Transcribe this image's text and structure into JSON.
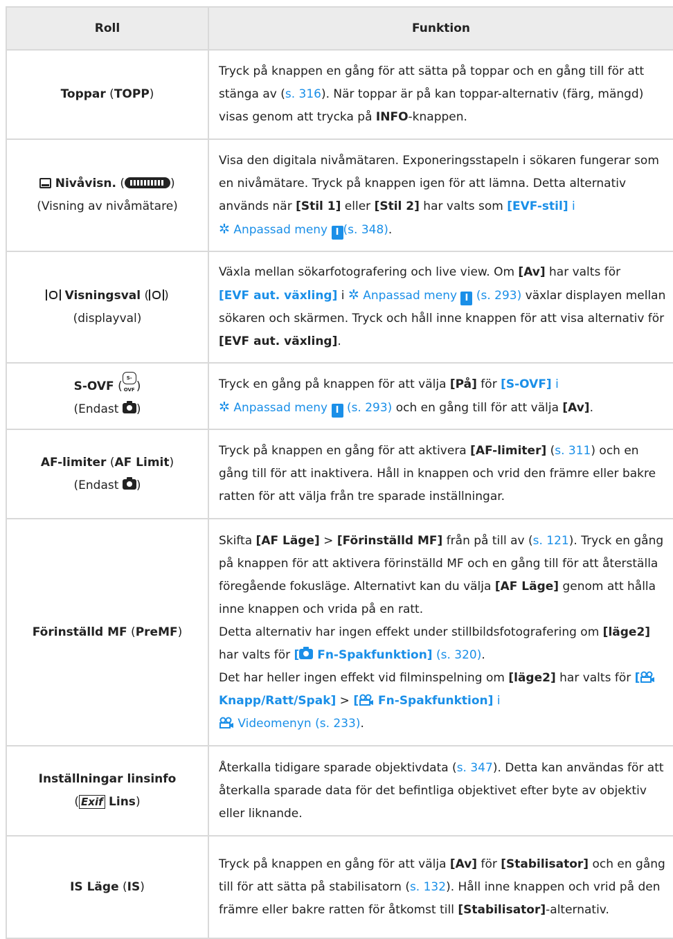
{
  "header": {
    "col1": "Roll",
    "col2": "Funktion"
  },
  "icons": {
    "gear": "gear-icon",
    "custom_menu_number": "I",
    "camera": "camera-icon",
    "video": "video-icon",
    "level": "level-display-icon",
    "level_bar": "level-gauge-icon",
    "display_select": "display-select-icon",
    "sovf": "S-OVF",
    "exif": "Exif"
  },
  "colors": {
    "link": "#1a8fe8",
    "header_bg": "#ececec",
    "border": "#d9d9d9"
  },
  "rows": [
    {
      "role": {
        "name": "Toppar",
        "abbr": "TOPP"
      },
      "func": {
        "t1": "Tryck på knappen en gång för att sätta på toppar och en gång till för att stänga av (",
        "ref1": "s. 316",
        "t2": "). När toppar är på kan toppar-alternativ (färg, mängd) visas genom att trycka på ",
        "b1": "INFO",
        "t3": "-knappen."
      }
    },
    {
      "role": {
        "name": "Nivåvisn.",
        "sub": "(Visning av nivåmätare)"
      },
      "func": {
        "t1": "Visa den digitala nivåmätaren. Exponeringsstapeln i sökaren fungerar som en nivåmätare. Tryck på knappen igen för att lämna. Detta alternativ används när ",
        "b1": "[Stil 1]",
        "t2": " eller ",
        "b2": "[Stil 2]",
        "t3": " har valts som ",
        "lb1": "[EVF-stil]",
        "l1": " i",
        "menu": " Anpassad meny ",
        "ref1": "(s. 348)",
        "t4": "."
      }
    },
    {
      "role": {
        "name": "Visningsval",
        "sub": "(displayval)"
      },
      "func": {
        "t1": "Växla mellan sökarfotografering och live view. Om ",
        "b1": "[Av]",
        "t2": " har valts för ",
        "lb1": "[EVF aut. växling]",
        "t3": " i ",
        "menu": " Anpassad meny ",
        "ref1": "(s. 293)",
        "t4": " växlar displayen mellan sökaren och skärmen. Tryck och håll inne knappen för att visa alternativ för ",
        "b2": "[EVF aut. växling]",
        "t5": "."
      }
    },
    {
      "role": {
        "name": "S-OVF",
        "sub": "(Endast "
      },
      "func": {
        "t1": "Tryck en gång på knappen för att välja ",
        "b1": "[På]",
        "t2": " för ",
        "lb1": "[S-OVF]",
        "l1": " i",
        "menu": " Anpassad meny ",
        "ref1": "(s. 293)",
        "t3": " och en gång till för att välja ",
        "b2": "[Av]",
        "t4": "."
      }
    },
    {
      "role": {
        "name": "AF-limiter",
        "abbr": "AF Limit",
        "sub": "(Endast "
      },
      "func": {
        "t1": "Tryck på knappen en gång för att aktivera ",
        "b1": "[AF-limiter]",
        "t2": " (",
        "ref1": "s. 311",
        "t3": ") och en gång till för att inaktivera. Håll in knappen och vrid den främre eller bakre ratten för att välja från tre sparade inställningar."
      }
    },
    {
      "role": {
        "name": "Förinställd MF",
        "abbr": "PreMF"
      },
      "func": {
        "t1": "Skifta ",
        "b1": "[AF Läge]",
        "t2": " > ",
        "b2": "[Förinställd MF]",
        "t3": " från på till av (",
        "ref1": "s. 121",
        "t4": "). Tryck en gång på knappen för att aktivera förinställd MF och en gång till för att återställa föregående fokusläge. Alternativt kan du välja ",
        "b3": "[AF Läge]",
        "t5": " genom att hålla inne knappen och vrida på en ratt.",
        "t6": "Detta alternativ har ingen effekt under stillbildsfotografering om ",
        "b4": "[läge2]",
        "t7": " har valts för ",
        "lb1a": "[",
        "lb1b": " Fn-Spakfunktion]",
        "ref2": " (s. 320)",
        "t8": ".",
        "t9": "Det har heller ingen effekt vid filminspelning om ",
        "b5": "[läge2]",
        "t10": " har valts för ",
        "lb2a": "[",
        "lb2b": " Knapp/Ratt/Spak]",
        "t11": " > ",
        "lb3a": "[",
        "lb3b": " Fn-Spakfunktion]",
        "l1": " i",
        "menu2": " Videomenyn ",
        "ref3": "(s. 233)",
        "t12": "."
      }
    },
    {
      "role": {
        "name": "Inställningar linsinfo",
        "abbr": "Lins"
      },
      "func": {
        "t1": "Återkalla tidigare sparade objektivdata (",
        "ref1": "s. 347",
        "t2": "). Detta kan användas för att återkalla sparade data för det befintliga objektivet efter byte av objektiv eller liknande."
      }
    },
    {
      "role": {
        "name": "IS Läge",
        "abbr": "IS"
      },
      "func": {
        "t1": "Tryck på knappen en gång för att välja ",
        "b1": "[Av]",
        "t2": " för ",
        "b2": "[Stabilisator]",
        "t3": " och en gång till för att sätta på stabilisatorn (",
        "ref1": "s. 132",
        "t4": "). Håll inne knappen och vrid på den främre eller bakre ratten för åtkomst till ",
        "b3": "[Stabilisator]",
        "t5": "-alternativ."
      }
    }
  ]
}
